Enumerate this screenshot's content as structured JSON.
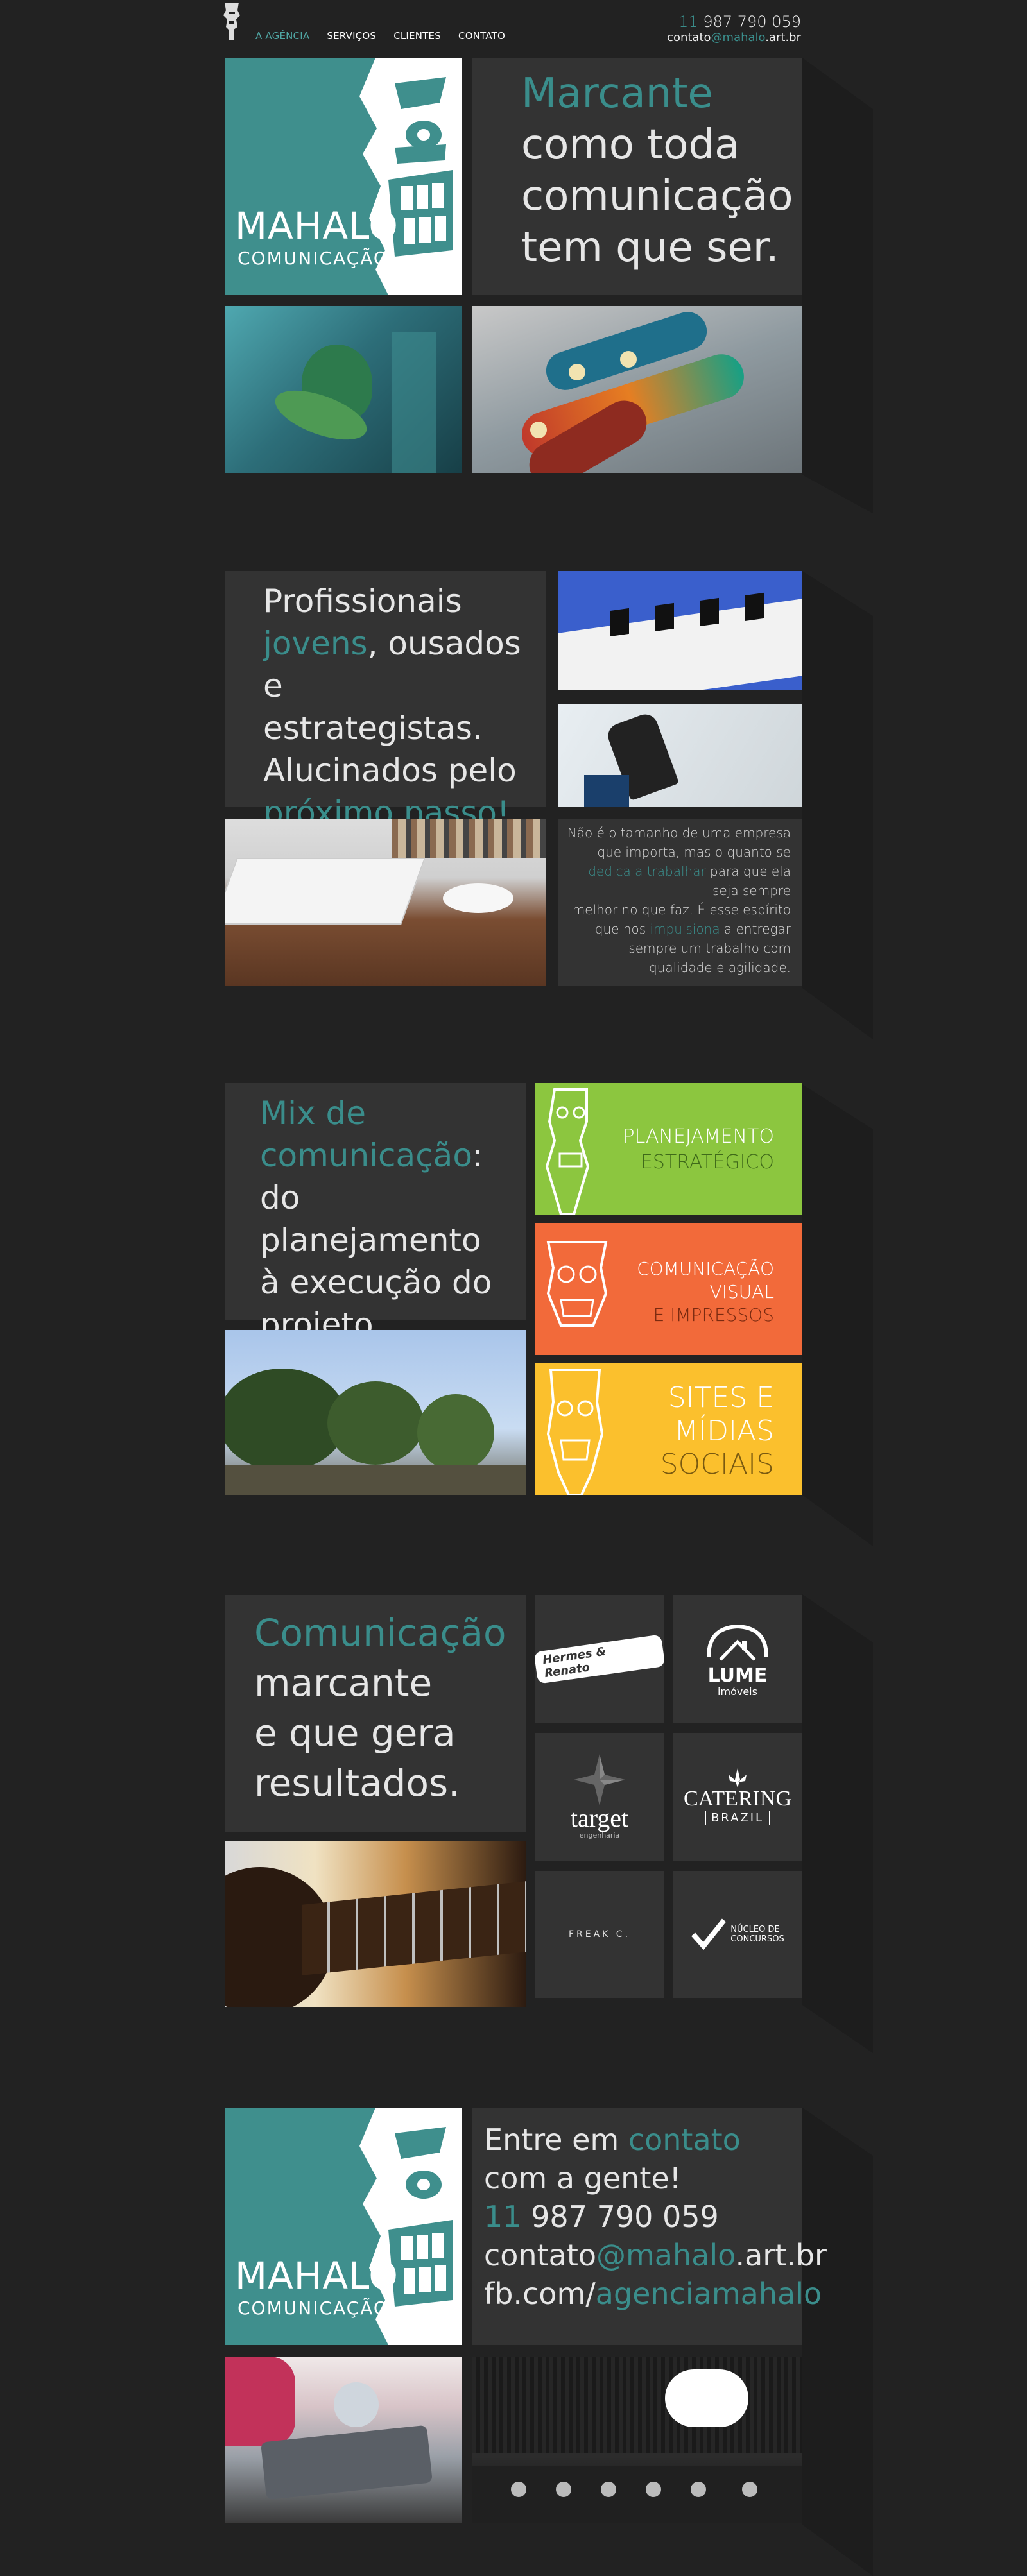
{
  "header": {
    "nav": [
      "A AGÊNCIA",
      "SERVIÇOS",
      "CLIENTES",
      "CONTATO"
    ],
    "phone_prefix": "11",
    "phone": "987 790 059",
    "email_user": "contato",
    "email_domain": "@mahalo",
    "email_tld": ".art.br"
  },
  "brand": {
    "name": "MAHALO",
    "sub": "COMUNICAÇÃO"
  },
  "hero": {
    "line1": "Marcante",
    "line2": "como toda",
    "line3": "comunicação",
    "line4": "tem que ser."
  },
  "about": {
    "l1": "Profissionais",
    "l2a": "jovens",
    "l2b": ", ousados e",
    "l3": "estrategistas.",
    "l4": "Alucinados pelo",
    "l5": "próximo passo!",
    "copy1": "Não é o tamanho de uma empresa",
    "copy2": "que importa, mas o quanto se",
    "copy3a": "dedica a trabalhar",
    "copy3b": " para que ela",
    "copy4": "seja sempre",
    "copy5": "melhor no que faz. É esse espírito",
    "copy6a": "que nos ",
    "copy6b": "impulsiona",
    "copy6c": " a entregar",
    "copy7": "sempre um trabalho com",
    "copy8": "qualidade e agilidade."
  },
  "services": {
    "h1": "Mix de",
    "h2a": "comunicação",
    "h2b": ":",
    "h3": "do planejamento",
    "h4": "à execução do",
    "h5": "projeto.",
    "items": [
      {
        "l1": "PLANEJAMENTO",
        "l2": "ESTRATÉGICO",
        "l3": ""
      },
      {
        "l1": "COMUNICAÇÃO",
        "l2": "VISUAL",
        "l3": "E IMPRESSOS"
      },
      {
        "l1": "SITES E",
        "l2": "MÍDIAS",
        "l3": "SOCIAIS"
      }
    ],
    "colors": [
      "#8cc63f",
      "#f26a3a",
      "#fbc02d"
    ]
  },
  "clients": {
    "h1": "Comunicação",
    "h2": "marcante",
    "h3": "e que gera",
    "h4": "resultados.",
    "logos": [
      "Hermes & Renato",
      "LUME",
      "imóveis",
      "target",
      "engenharia",
      "CATERING",
      "BRAZIL",
      "FREAK C.",
      "NÚCLEO DE",
      "CONCURSOS"
    ]
  },
  "contact": {
    "l1a": "Entre em ",
    "l1b": "contato",
    "l2": "com a gente!",
    "phone_prefix": "11",
    "phone": " 987 790 059",
    "email_user": "contato",
    "email_domain": "@mahalo",
    "email_tld": ".art.br",
    "fb_prefix": "fb.com/",
    "fb_handle": "agenciamahalo"
  },
  "colors": {
    "accent": "#3a8d8b",
    "brand_bg": "#3f8f8d",
    "panel": "#333333",
    "page": "#222222"
  }
}
